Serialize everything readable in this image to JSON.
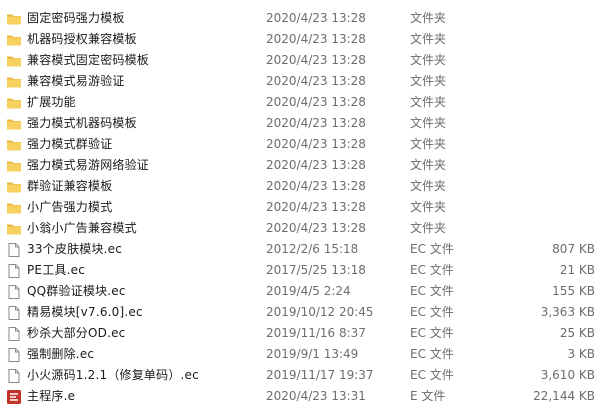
{
  "colors": {
    "folder": "#f7d15f",
    "folder_tab": "#e8b73c",
    "file_outline": "#8a8a8a",
    "exe_icon": "#c4322c",
    "secondary_text": "#6d6d6d"
  },
  "files": [
    {
      "name": "固定密码强力模板",
      "date": "2020/4/23 13:28",
      "type": "文件夹",
      "size": "",
      "icon": "folder-icon"
    },
    {
      "name": "机器码授权兼容模板",
      "date": "2020/4/23 13:28",
      "type": "文件夹",
      "size": "",
      "icon": "folder-icon"
    },
    {
      "name": "兼容模式固定密码模板",
      "date": "2020/4/23 13:28",
      "type": "文件夹",
      "size": "",
      "icon": "folder-icon"
    },
    {
      "name": "兼容模式易游验证",
      "date": "2020/4/23 13:28",
      "type": "文件夹",
      "size": "",
      "icon": "folder-icon"
    },
    {
      "name": "扩展功能",
      "date": "2020/4/23 13:28",
      "type": "文件夹",
      "size": "",
      "icon": "folder-icon"
    },
    {
      "name": "强力模式机器码模板",
      "date": "2020/4/23 13:28",
      "type": "文件夹",
      "size": "",
      "icon": "folder-icon"
    },
    {
      "name": "强力模式群验证",
      "date": "2020/4/23 13:28",
      "type": "文件夹",
      "size": "",
      "icon": "folder-icon"
    },
    {
      "name": "强力模式易游网络验证",
      "date": "2020/4/23 13:28",
      "type": "文件夹",
      "size": "",
      "icon": "folder-icon"
    },
    {
      "name": "群验证兼容模板",
      "date": "2020/4/23 13:28",
      "type": "文件夹",
      "size": "",
      "icon": "folder-icon"
    },
    {
      "name": "小广告强力模式",
      "date": "2020/4/23 13:28",
      "type": "文件夹",
      "size": "",
      "icon": "folder-icon"
    },
    {
      "name": "小翁小广告兼容模式",
      "date": "2020/4/23 13:28",
      "type": "文件夹",
      "size": "",
      "icon": "folder-icon"
    },
    {
      "name": "33个皮肤模块.ec",
      "date": "2012/2/6 15:18",
      "type": "EC 文件",
      "size": "807 KB",
      "icon": "file-icon"
    },
    {
      "name": "PE工具.ec",
      "date": "2017/5/25 13:18",
      "type": "EC 文件",
      "size": "21 KB",
      "icon": "file-icon"
    },
    {
      "name": "QQ群验证模块.ec",
      "date": "2019/4/5 2:24",
      "type": "EC 文件",
      "size": "155 KB",
      "icon": "file-icon"
    },
    {
      "name": "精易模块[v7.6.0].ec",
      "date": "2019/10/12 20:45",
      "type": "EC 文件",
      "size": "3,363 KB",
      "icon": "file-icon"
    },
    {
      "name": "秒杀大部分OD.ec",
      "date": "2019/11/16 8:37",
      "type": "EC 文件",
      "size": "25 KB",
      "icon": "file-icon"
    },
    {
      "name": "强制删除.ec",
      "date": "2019/9/1 13:49",
      "type": "EC 文件",
      "size": "3 KB",
      "icon": "file-icon"
    },
    {
      "name": "小火源码1.2.1（修复单码）.ec",
      "date": "2019/11/17 19:37",
      "type": "EC 文件",
      "size": "3,610 KB",
      "icon": "file-icon"
    },
    {
      "name": "主程序.e",
      "date": "2020/4/23 13:31",
      "type": "E 文件",
      "size": "22,144 KB",
      "icon": "e-source-icon"
    }
  ]
}
